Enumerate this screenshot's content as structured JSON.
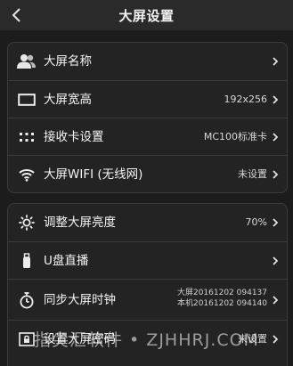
{
  "header": {
    "title": "大屏设置",
    "back_icon": "back-chevron-icon"
  },
  "group1": {
    "items": [
      {
        "label": "大屏名称",
        "value": "",
        "icon": "contacts-icon"
      },
      {
        "label": "大屏宽高",
        "value": "192x256",
        "icon": "screen-rect-icon"
      },
      {
        "label": "接收卡设置",
        "value": "MC100标准卡",
        "icon": "grid-dots-icon"
      },
      {
        "label": "大屏WIFI (无线网)",
        "value": "未设置",
        "icon": "wifi-icon"
      }
    ]
  },
  "group2": {
    "items": [
      {
        "label": "调整大屏亮度",
        "value": "70%",
        "icon": "brightness-icon"
      },
      {
        "label": "U盘直播",
        "value": "",
        "icon": "usb-drive-icon"
      },
      {
        "label": "同步大屏时钟",
        "value_line1": "大屏20161202 094137",
        "value_line2": "本机20161202 094140",
        "icon": "stopwatch-icon"
      },
      {
        "label": "设置大屏密码",
        "value": "未设置",
        "icon": "lock-screen-icon"
      }
    ]
  },
  "watermark": "指尖汇软件 • ZJHHRJ.COM"
}
